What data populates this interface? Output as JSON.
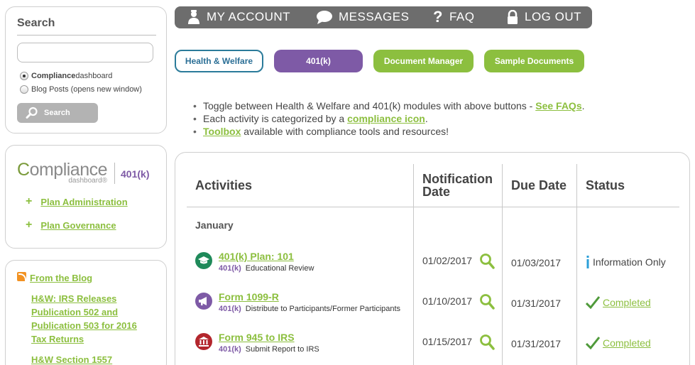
{
  "search": {
    "title": "Search",
    "input_value": "",
    "option_1_bold": "Compliance",
    "option_1_rest": "dashboard",
    "option_2": "Blog Posts (opens new window)",
    "button_label": "Search"
  },
  "logo": {
    "c": "C",
    "main": "ompliance",
    "sub": "dashboard®",
    "module": "401(k)"
  },
  "sidebar_links": [
    {
      "label": "Plan Administration"
    },
    {
      "label": "Plan Governance"
    }
  ],
  "blog": {
    "heading": "From the Blog",
    "posts": [
      {
        "label": "H&W: IRS Releases Publication 502 and Publication 503 for 2016 Tax Returns"
      },
      {
        "label": "H&W Section 1557"
      }
    ]
  },
  "nav": {
    "account": "MY ACCOUNT",
    "messages": "MESSAGES",
    "faq": "FAQ",
    "logout": "LOG OUT"
  },
  "modules": {
    "hw": "Health & Welfare",
    "k401": "401(k)",
    "doc_manager": "Document Manager",
    "sample_docs": "Sample Documents"
  },
  "info": {
    "line1_text": "Toggle between Health & Welfare and 401(k) modules with above buttons - ",
    "line1_link": "See FAQs",
    "line1_end": ".",
    "line2_text": "Each activity is categorized by a ",
    "line2_link": "compliance icon",
    "line2_end": ".",
    "line3_link": "Toolbox",
    "line3_text": " available with compliance tools and resources!"
  },
  "table": {
    "headers": {
      "activities": "Activities",
      "notification_1": "Notification",
      "notification_2": "Date",
      "due": "Due Date",
      "status": "Status"
    },
    "month": "January",
    "rows": [
      {
        "title": "401(k) Plan: 101",
        "tag": "401(k)",
        "desc": "Educational Review",
        "notif": "01/02/2017",
        "due": "01/03/2017",
        "status": "Information Only",
        "icon_color": "#1f8a5a"
      },
      {
        "title": "Form 1099-R",
        "tag": "401(k)",
        "desc": "Distribute to Participants/Former Participants",
        "notif": "01/10/2017",
        "due": "01/31/2017",
        "status": "Completed",
        "icon_color": "#7e5aa6"
      },
      {
        "title": "Form 945 to IRS",
        "tag": "401(k)",
        "desc": "Submit Report to IRS",
        "notif": "01/15/2017",
        "due": "01/31/2017",
        "status": "Completed",
        "icon_color": "#b3262d"
      }
    ]
  },
  "colors": {
    "green": "#8cbf3f",
    "purple": "#7e5aa6",
    "nav_gray": "#6d6d6d",
    "hw_blue": "#2b6f96"
  }
}
